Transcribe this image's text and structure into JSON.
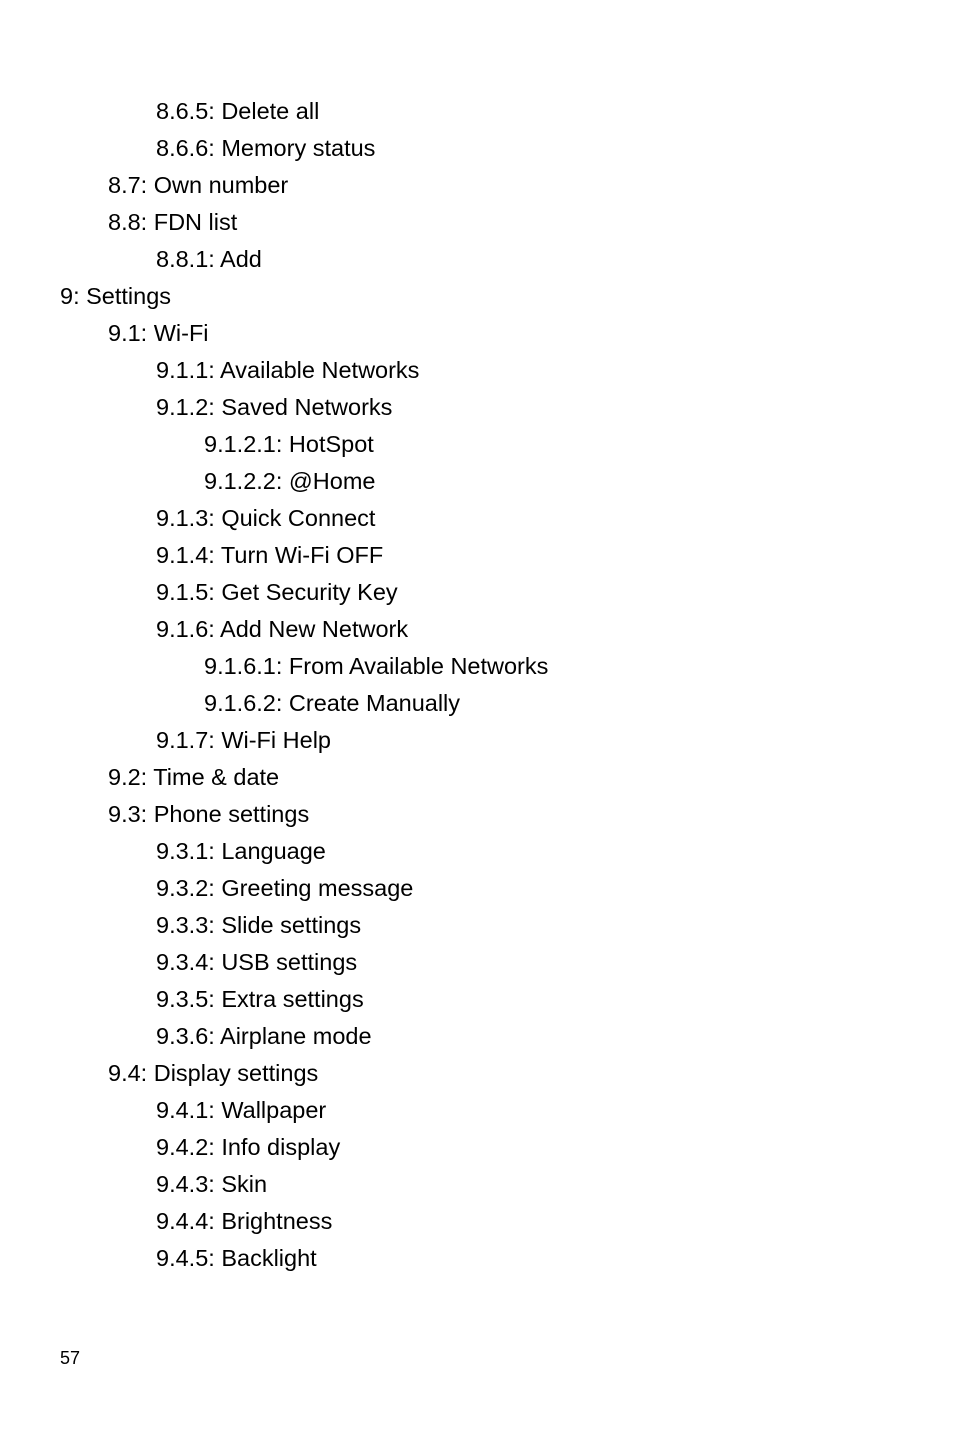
{
  "menu": [
    {
      "level": 3,
      "text": "8.6.5: Delete all"
    },
    {
      "level": 3,
      "text": "8.6.6: Memory status"
    },
    {
      "level": 2,
      "text": "8.7: Own number"
    },
    {
      "level": 2,
      "text": "8.8: FDN list"
    },
    {
      "level": 3,
      "text": "8.8.1: Add"
    },
    {
      "level": 1,
      "text": "9: Settings"
    },
    {
      "level": 2,
      "text": "9.1: Wi-Fi"
    },
    {
      "level": 3,
      "text": "9.1.1: Available Networks"
    },
    {
      "level": 3,
      "text": "9.1.2: Saved Networks"
    },
    {
      "level": 4,
      "text": "9.1.2.1: HotSpot"
    },
    {
      "level": 4,
      "text": "9.1.2.2: @Home"
    },
    {
      "level": 3,
      "text": "9.1.3: Quick Connect"
    },
    {
      "level": 3,
      "text": "9.1.4: Turn Wi-Fi OFF"
    },
    {
      "level": 3,
      "text": "9.1.5: Get Security Key"
    },
    {
      "level": 3,
      "text": "9.1.6: Add New Network"
    },
    {
      "level": 4,
      "text": "9.1.6.1: From Available Networks"
    },
    {
      "level": 4,
      "text": "9.1.6.2: Create Manually"
    },
    {
      "level": 3,
      "text": "9.1.7: Wi-Fi Help"
    },
    {
      "level": 2,
      "text": "9.2: Time & date"
    },
    {
      "level": 2,
      "text": "9.3: Phone settings"
    },
    {
      "level": 3,
      "text": "9.3.1: Language"
    },
    {
      "level": 3,
      "text": "9.3.2: Greeting message"
    },
    {
      "level": 3,
      "text": "9.3.3: Slide settings"
    },
    {
      "level": 3,
      "text": "9.3.4: USB settings"
    },
    {
      "level": 3,
      "text": "9.3.5: Extra settings"
    },
    {
      "level": 3,
      "text": "9.3.6: Airplane mode"
    },
    {
      "level": 2,
      "text": "9.4: Display settings"
    },
    {
      "level": 3,
      "text": "9.4.1: Wallpaper"
    },
    {
      "level": 3,
      "text": "9.4.2: Info display"
    },
    {
      "level": 3,
      "text": "9.4.3: Skin"
    },
    {
      "level": 3,
      "text": "9.4.4: Brightness"
    },
    {
      "level": 3,
      "text": "9.4.5: Backlight"
    }
  ],
  "pageNumber": "57"
}
